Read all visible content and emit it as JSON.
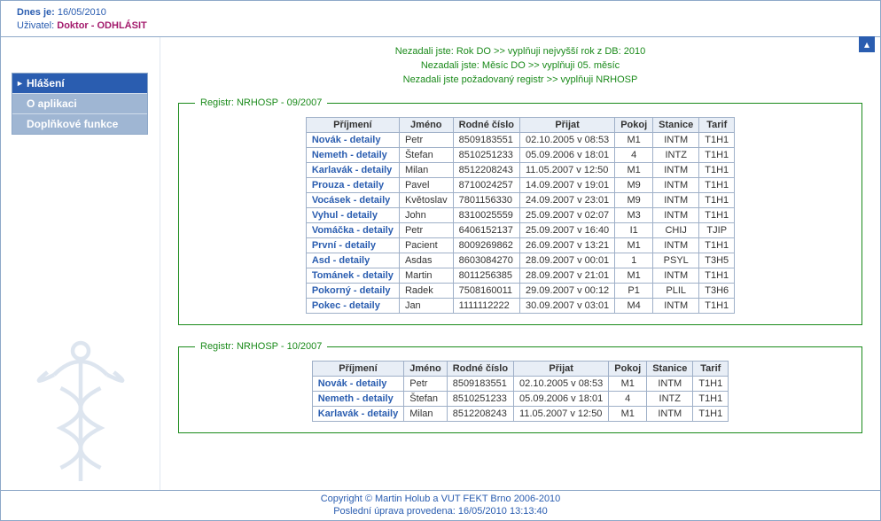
{
  "header": {
    "date_label": "Dnes je:",
    "date_value": "16/05/2010",
    "user_label": "Uživatel:",
    "user_value": "Doktor",
    "logout": "ODHLÁSIT"
  },
  "sidebar": {
    "items": [
      {
        "label": "Hlášení",
        "active": true
      },
      {
        "label": "O aplikaci",
        "active": false
      },
      {
        "label": "Doplňkové funkce",
        "active": false
      }
    ]
  },
  "notices": [
    "Nezadali jste: Rok DO >> vyplňuji nejvyšší rok z DB: 2010",
    "Nezadali jste: Měsíc DO >> vyplňuji 05. měsíc",
    "Nezadali jste požadovaný registr >> vyplňuji NRHOSP"
  ],
  "table_headers": [
    "Příjmení",
    "Jméno",
    "Rodné číslo",
    "Přijat",
    "Pokoj",
    "Stanice",
    "Tarif"
  ],
  "registers": [
    {
      "legend": "Registr: NRHOSP - 09/2007",
      "rows": [
        {
          "surname": "Novák - detaily",
          "name": "Petr",
          "rc": "8509183551",
          "admitted": "02.10.2005 v 08:53",
          "room": "M1",
          "station": "INTM",
          "tariff": "T1H1"
        },
        {
          "surname": "Nemeth - detaily",
          "name": "Štefan",
          "rc": "8510251233",
          "admitted": "05.09.2006 v 18:01",
          "room": "4",
          "station": "INTZ",
          "tariff": "T1H1"
        },
        {
          "surname": "Karlavák - detaily",
          "name": "Milan",
          "rc": "8512208243",
          "admitted": "11.05.2007 v 12:50",
          "room": "M1",
          "station": "INTM",
          "tariff": "T1H1"
        },
        {
          "surname": "Prouza - detaily",
          "name": "Pavel",
          "rc": "8710024257",
          "admitted": "14.09.2007 v 19:01",
          "room": "M9",
          "station": "INTM",
          "tariff": "T1H1"
        },
        {
          "surname": "Vocásek - detaily",
          "name": "Květoslav",
          "rc": "7801156330",
          "admitted": "24.09.2007 v 23:01",
          "room": "M9",
          "station": "INTM",
          "tariff": "T1H1"
        },
        {
          "surname": "Vyhul - detaily",
          "name": "John",
          "rc": "8310025559",
          "admitted": "25.09.2007 v 02:07",
          "room": "M3",
          "station": "INTM",
          "tariff": "T1H1"
        },
        {
          "surname": "Vomáčka - detaily",
          "name": "Petr",
          "rc": "6406152137",
          "admitted": "25.09.2007 v 16:40",
          "room": "I1",
          "station": "CHIJ",
          "tariff": "TJIP"
        },
        {
          "surname": "První - detaily",
          "name": "Pacient",
          "rc": "8009269862",
          "admitted": "26.09.2007 v 13:21",
          "room": "M1",
          "station": "INTM",
          "tariff": "T1H1"
        },
        {
          "surname": "Asd - detaily",
          "name": "Asdas",
          "rc": "8603084270",
          "admitted": "28.09.2007 v 00:01",
          "room": "1",
          "station": "PSYL",
          "tariff": "T3H5"
        },
        {
          "surname": "Tománek - detaily",
          "name": "Martin",
          "rc": "8011256385",
          "admitted": "28.09.2007 v 21:01",
          "room": "M1",
          "station": "INTM",
          "tariff": "T1H1"
        },
        {
          "surname": "Pokorný - detaily",
          "name": "Radek",
          "rc": "7508160011",
          "admitted": "29.09.2007 v 00:12",
          "room": "P1",
          "station": "PLIL",
          "tariff": "T3H6"
        },
        {
          "surname": "Pokec - detaily",
          "name": "Jan",
          "rc": "1111112222",
          "admitted": "30.09.2007 v 03:01",
          "room": "M4",
          "station": "INTM",
          "tariff": "T1H1"
        }
      ]
    },
    {
      "legend": "Registr: NRHOSP - 10/2007",
      "rows": [
        {
          "surname": "Novák - detaily",
          "name": "Petr",
          "rc": "8509183551",
          "admitted": "02.10.2005 v 08:53",
          "room": "M1",
          "station": "INTM",
          "tariff": "T1H1"
        },
        {
          "surname": "Nemeth - detaily",
          "name": "Štefan",
          "rc": "8510251233",
          "admitted": "05.09.2006 v 18:01",
          "room": "4",
          "station": "INTZ",
          "tariff": "T1H1"
        },
        {
          "surname": "Karlavák - detaily",
          "name": "Milan",
          "rc": "8512208243",
          "admitted": "11.05.2007 v 12:50",
          "room": "M1",
          "station": "INTM",
          "tariff": "T1H1"
        }
      ]
    }
  ],
  "footer": {
    "copyright": "Copyright © Martin Holub a VUT FEKT Brno 2006-2010",
    "last_update": "Poslední úprava provedena: 16/05/2010 13:13:40"
  }
}
